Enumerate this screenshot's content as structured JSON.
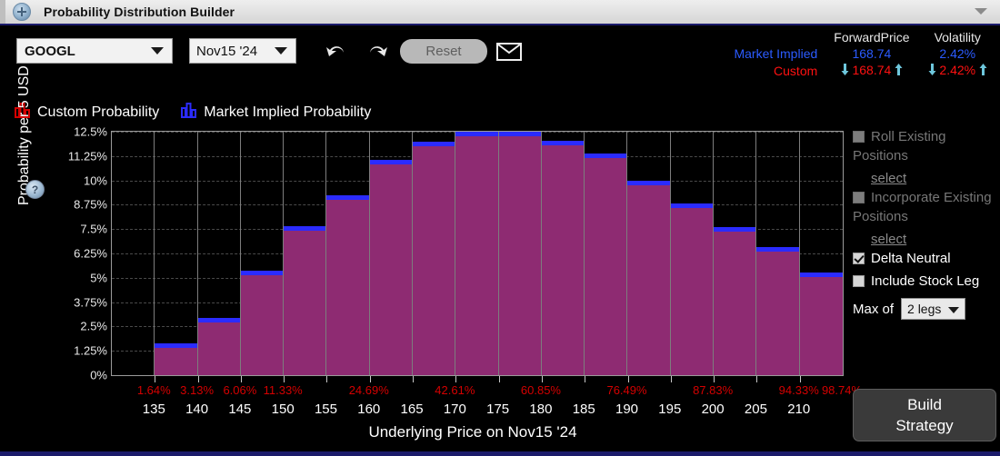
{
  "window": {
    "title": "Probability Distribution Builder",
    "app_icon": "circle-plus-icon",
    "menu_caret": "chevron-down-icon"
  },
  "toolbar": {
    "symbol": {
      "value": "GOOGL",
      "icon": "chevron-down-icon"
    },
    "expiry": {
      "value": "Nov15 '24",
      "icon": "chevron-down-icon"
    },
    "undo_icon": "undo-arrow-icon",
    "redo_icon": "redo-arrow-icon",
    "reset_label": "Reset",
    "mail_icon": "envelope-icon"
  },
  "legend": [
    {
      "label": "Custom Probability",
      "color": "#d40000",
      "icon": "bar-chart-icon"
    },
    {
      "label": "Market Implied Probability",
      "color": "#2b2bff",
      "icon": "bar-chart-icon"
    }
  ],
  "stats": {
    "col_forward": "ForwardPrice",
    "col_volatility": "Volatility",
    "rows": [
      {
        "label": "Market Implied",
        "forward_price": "168.74",
        "volatility": "2.42%",
        "color": "#2b5bff",
        "steppers": false
      },
      {
        "label": "Custom",
        "forward_price": "168.74",
        "volatility": "2.42%",
        "color": "#ff1111",
        "steppers": true
      }
    ]
  },
  "chart_data": {
    "type": "bar",
    "title": "",
    "xlabel": "Underlying Price on Nov15 '24",
    "ylabel": "Probability per 5 USD",
    "ylim": [
      0,
      12.5
    ],
    "yticks": [
      "0%",
      "1.25%",
      "2.5%",
      "3.75%",
      "5%",
      "6.25%",
      "7.5%",
      "8.75%",
      "10%",
      "11.25%",
      "12.5%"
    ],
    "ytick_values": [
      0,
      1.25,
      2.5,
      3.75,
      5,
      6.25,
      7.5,
      8.75,
      10,
      11.25,
      12.5
    ],
    "grid": true,
    "legend_position": "top-left",
    "bin_width": 5,
    "bin_edges": [
      130,
      135,
      140,
      145,
      150,
      155,
      160,
      165,
      170,
      175,
      180,
      185,
      190,
      195,
      200,
      205,
      210,
      215
    ],
    "categories": [
      "130-135",
      "135-140",
      "140-145",
      "145-150",
      "150-155",
      "155-160",
      "160-165",
      "165-170",
      "170-175",
      "175-180",
      "180-185",
      "185-190",
      "190-195",
      "195-200",
      "200-205",
      "205-210",
      "210-215"
    ],
    "values": [
      0,
      1.62,
      2.95,
      5.37,
      7.65,
      9.22,
      11.05,
      11.97,
      12.5,
      12.5,
      12.05,
      11.4,
      10.0,
      8.8,
      7.6,
      6.6,
      5.25
    ],
    "xticks": [
      135,
      140,
      145,
      150,
      155,
      160,
      165,
      170,
      175,
      180,
      185,
      190,
      195,
      200,
      205,
      210
    ],
    "xticklabels": [
      "135",
      "140",
      "145",
      "150",
      "155",
      "160",
      "165",
      "170",
      "175",
      "180",
      "185",
      "190",
      "195",
      "200",
      "205",
      "210"
    ],
    "cumulative_labels": [
      {
        "price": 135,
        "text": "1.64%"
      },
      {
        "price": 140,
        "text": "3.13%"
      },
      {
        "price": 145,
        "text": "6.06%"
      },
      {
        "price": 150,
        "text": "11.33%"
      },
      {
        "price": 160,
        "text": "24.69%"
      },
      {
        "price": 170,
        "text": "42.61%"
      },
      {
        "price": 180,
        "text": "60.85%"
      },
      {
        "price": 190,
        "text": "76.49%"
      },
      {
        "price": 200,
        "text": "87.83%"
      },
      {
        "price": 210,
        "text": "94.33%"
      },
      {
        "price": 225,
        "text": "98.74%"
      }
    ],
    "bar_fill_color": "#8e2b72",
    "bar_cap_color": "#2b2bff",
    "background": "#000000",
    "note": "Market-implied distribution (blue caps) overlaid with custom distribution (purple fill); last bin at far right is empty."
  },
  "chart_help_icon": "help-icon",
  "panel": {
    "options": [
      {
        "label": "Roll Existing Positions",
        "checked": false,
        "disabled": true,
        "link": "select"
      },
      {
        "label": "Incorporate Existing Positions",
        "checked": false,
        "disabled": true,
        "link": "select"
      },
      {
        "label": "Delta Neutral",
        "checked": true,
        "disabled": false
      },
      {
        "label": "Include Stock Leg",
        "checked": false,
        "disabled": false
      }
    ],
    "max_of_label": "Max of",
    "legs_value": "2 legs",
    "legs_icon": "chevron-down-icon",
    "build_line1": "Build",
    "build_line2": "Strategy"
  }
}
